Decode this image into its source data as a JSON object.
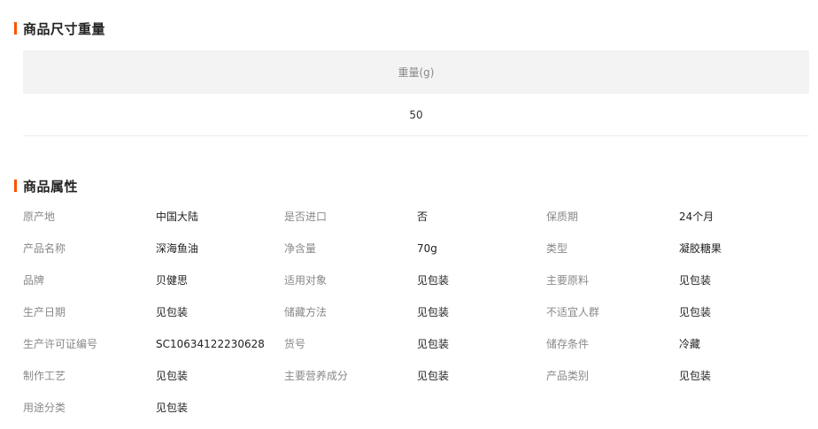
{
  "size_section": {
    "title": "商品尺寸重量",
    "header": "重量(g)",
    "value": "50"
  },
  "attr_section": {
    "title": "商品属性",
    "rows": [
      [
        {
          "label": "原产地",
          "value": "中国大陆"
        },
        {
          "label": "是否进口",
          "value": "否"
        },
        {
          "label": "保质期",
          "value": "24个月"
        }
      ],
      [
        {
          "label": "产品名称",
          "value": "深海鱼油"
        },
        {
          "label": "净含量",
          "value": "70g"
        },
        {
          "label": "类型",
          "value": "凝胶糖果"
        }
      ],
      [
        {
          "label": "品牌",
          "value": "贝健思"
        },
        {
          "label": "适用对象",
          "value": "见包装"
        },
        {
          "label": "主要原料",
          "value": "见包装"
        }
      ],
      [
        {
          "label": "生产日期",
          "value": "见包装"
        },
        {
          "label": "储藏方法",
          "value": "见包装"
        },
        {
          "label": "不适宜人群",
          "value": "见包装"
        }
      ],
      [
        {
          "label": "生产许可证编号",
          "value": "SC10634122230628"
        },
        {
          "label": "货号",
          "value": "见包装"
        },
        {
          "label": "储存条件",
          "value": "冷藏"
        }
      ],
      [
        {
          "label": "制作工艺",
          "value": "见包装"
        },
        {
          "label": "主要营养成分",
          "value": "见包装"
        },
        {
          "label": "产品类别",
          "value": "见包装"
        }
      ],
      [
        {
          "label": "用途分类",
          "value": "见包装"
        }
      ]
    ]
  },
  "colors": {
    "accent": "#ff5000",
    "header_bg": "#f3f3f3",
    "label": "#888888",
    "value": "#222222"
  }
}
